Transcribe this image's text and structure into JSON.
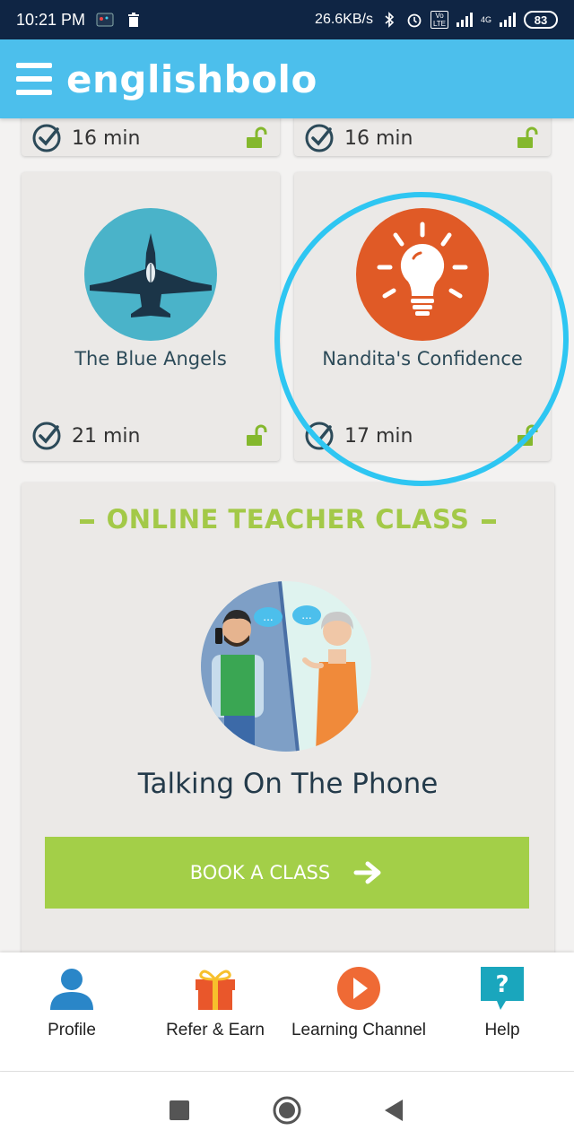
{
  "status_bar": {
    "time": "10:21 PM",
    "speed": "26.6KB/s",
    "battery": "83",
    "volte_label": "Vo LTE",
    "network_4g": "4G"
  },
  "app": {
    "brand": "englishbolo",
    "brand_color": "#4cbfec"
  },
  "lessons": [
    {
      "title": "",
      "duration": "16 min",
      "locked": false
    },
    {
      "title": "",
      "duration": "16 min",
      "locked": false
    },
    {
      "title": "The Blue Angels",
      "duration": "21 min",
      "icon": "jet-icon",
      "circle_color": "#4ab3c9",
      "locked": false
    },
    {
      "title": "Nandita's Confidence",
      "duration": "17 min",
      "icon": "lightbulb-icon",
      "circle_color": "#e05a26",
      "locked": false
    }
  ],
  "online_class": {
    "header": "ONLINE TEACHER CLASS",
    "topic": "Talking On The Phone",
    "button_label": "BOOK A CLASS",
    "accent_color": "#a3cf48"
  },
  "bottom_nav": [
    {
      "label": "Profile",
      "icon": "profile-icon"
    },
    {
      "label": "Refer & Earn",
      "icon": "gift-icon"
    },
    {
      "label": "Learning Channel",
      "icon": "play-icon"
    },
    {
      "label": "Help",
      "icon": "help-icon"
    }
  ],
  "system_nav": [
    "recents-button",
    "home-button",
    "back-button"
  ]
}
